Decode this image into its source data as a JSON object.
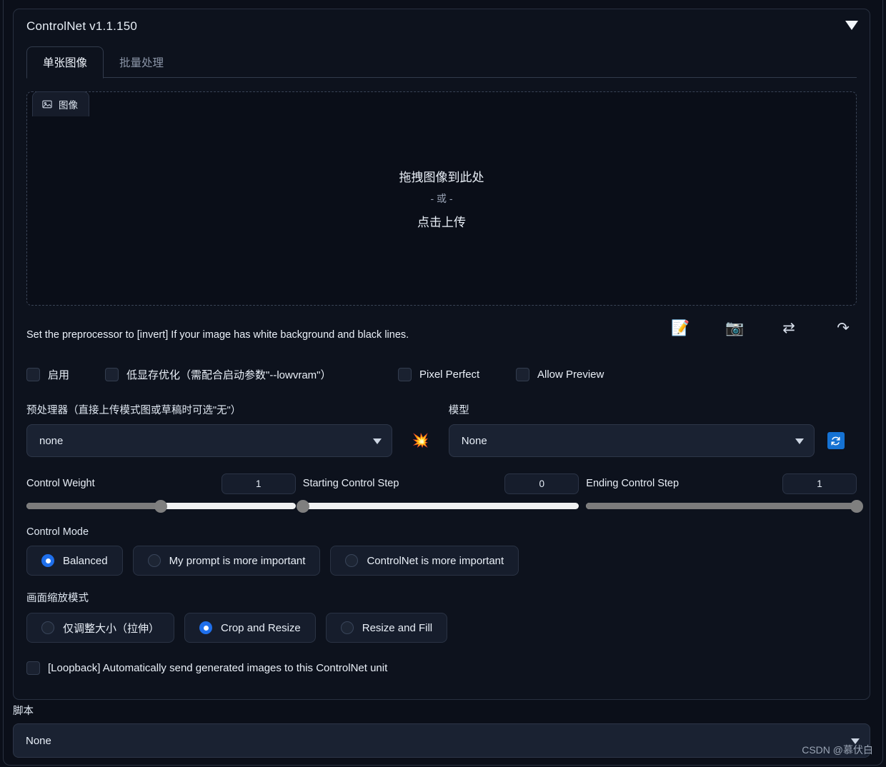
{
  "panel": {
    "title": "ControlNet v1.1.150",
    "collapse_icon": "caret-down-icon"
  },
  "tabs": [
    {
      "label": "单张图像",
      "active": true
    },
    {
      "label": "批量处理",
      "active": false
    }
  ],
  "image_area": {
    "chip_label": "图像",
    "chip_icon": "image-icon",
    "drop_line1": "拖拽图像到此处",
    "drop_or": "- 或 -",
    "drop_line2": "点击上传"
  },
  "hint": {
    "text": "Set the preprocessor to [invert] If your image has white background and black lines.",
    "icons": [
      {
        "name": "edit-memo-icon",
        "glyph": "📝"
      },
      {
        "name": "camera-icon",
        "glyph": "📷"
      },
      {
        "name": "swap-arrows-icon",
        "glyph": "⇄"
      },
      {
        "name": "send-arrow-icon",
        "glyph": "↷"
      }
    ]
  },
  "checkboxes": [
    {
      "label": "启用",
      "checked": false
    },
    {
      "label": "低显存优化（需配合启动参数\"--lowvram\"）",
      "checked": false
    },
    {
      "label": "Pixel Perfect",
      "checked": false
    },
    {
      "label": "Allow Preview",
      "checked": false
    }
  ],
  "selectors": {
    "preprocessor": {
      "label": "预处理器（直接上传模式图或草稿时可选\"无\"）",
      "value": "none"
    },
    "explode_button_icon": "💥",
    "model": {
      "label": "模型",
      "value": "None"
    },
    "refresh_button_icon": "🔄"
  },
  "sliders": [
    {
      "label": "Control Weight",
      "value": "1",
      "percent": 50
    },
    {
      "label": "Starting Control Step",
      "value": "0",
      "percent": 0
    },
    {
      "label": "Ending Control Step",
      "value": "1",
      "percent": 100
    }
  ],
  "control_mode": {
    "label": "Control Mode",
    "options": [
      {
        "label": "Balanced",
        "selected": true
      },
      {
        "label": "My prompt is more important",
        "selected": false
      },
      {
        "label": "ControlNet is more important",
        "selected": false
      }
    ]
  },
  "resize_mode": {
    "label": "画面缩放模式",
    "options": [
      {
        "label": "仅调整大小（拉伸）",
        "selected": false
      },
      {
        "label": "Crop and Resize",
        "selected": true
      },
      {
        "label": "Resize and Fill",
        "selected": false
      }
    ]
  },
  "loopback": {
    "label": "[Loopback] Automatically send generated images to this ControlNet unit",
    "checked": false
  },
  "scripts": {
    "label": "脚本",
    "value": "None"
  },
  "watermark": "CSDN @慕伏白",
  "colors": {
    "accent_blue": "#1f6feb",
    "refresh_blue": "#1572d3",
    "panel_bg": "#0d121d",
    "page_bg": "#0b0f19",
    "slider_track": "#f0f1f2",
    "slider_fill": "#7c7c7c"
  }
}
